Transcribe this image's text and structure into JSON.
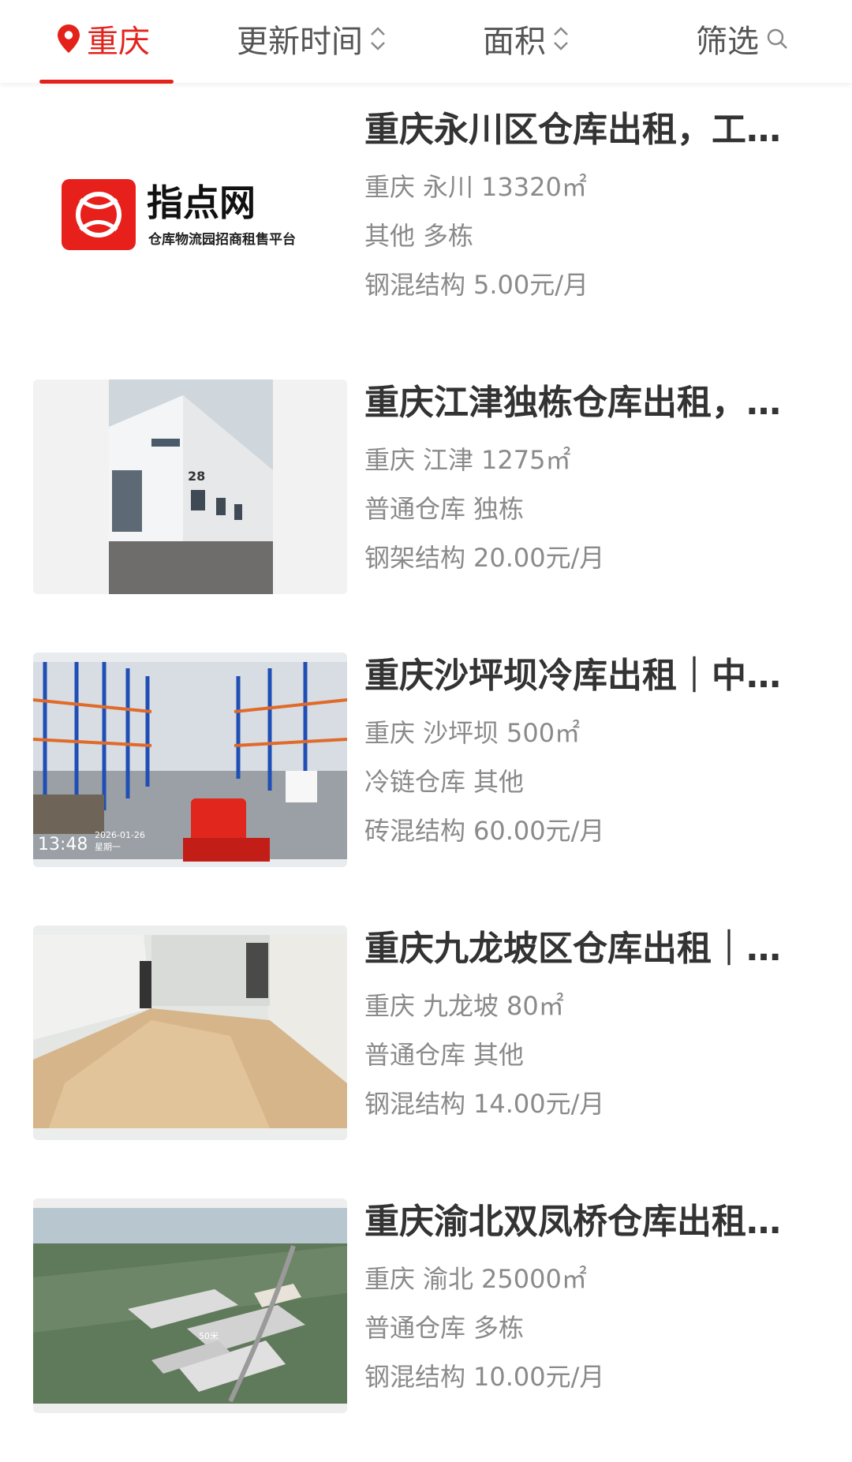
{
  "tabs": {
    "city": "重庆",
    "update_time": "更新时间",
    "area": "面积",
    "filter": "筛选"
  },
  "colors": {
    "accent": "#e3231b",
    "text_primary": "#333333",
    "text_secondary": "#8a8a8a"
  },
  "listings": [
    {
      "title": "重庆永川区仓库出租，工业园区…",
      "city": "重庆",
      "district": "永川",
      "area": "13320㎡",
      "type": "其他",
      "building": "多栋",
      "structure": "钢混结构",
      "price": "5.00元/月",
      "thumb_logo": {
        "name": "指点网",
        "tagline": "仓库物流园招商租售平台"
      }
    },
    {
      "title": "重庆江津独栋仓库出租，…",
      "city": "重庆",
      "district": "江津",
      "area": "1275㎡",
      "type": "普通仓库",
      "building": "独栋",
      "structure": "钢架结构",
      "price": "20.00元/月",
      "thumb_text": "28"
    },
    {
      "title": "重庆沙坪坝冷库出租｜中…",
      "city": "重庆",
      "district": "沙坪坝",
      "area": "500㎡",
      "type": "冷链仓库",
      "building": "其他",
      "structure": "砖混结构",
      "price": "60.00元/月",
      "thumb_time": "13:48",
      "thumb_date": "2026-01-26",
      "thumb_weekday": "星期一"
    },
    {
      "title": "重庆九龙坡区仓库出租｜…",
      "city": "重庆",
      "district": "九龙坡",
      "area": "80㎡",
      "type": "普通仓库",
      "building": "其他",
      "structure": "钢混结构",
      "price": "14.00元/月"
    },
    {
      "title": "重庆渝北双凤桥仓库出租…",
      "city": "重庆",
      "district": "渝北",
      "area": "25000㎡",
      "type": "普通仓库",
      "building": "多栋",
      "structure": "钢混结构",
      "price": "10.00元/月",
      "thumb_text": "50米"
    }
  ]
}
